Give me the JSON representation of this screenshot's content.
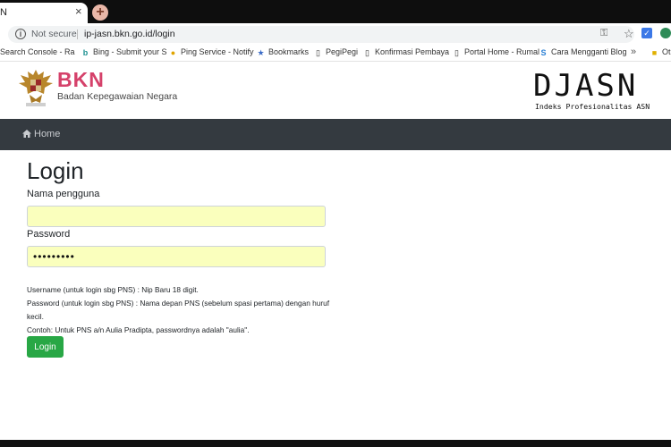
{
  "browser": {
    "tab_title": "N",
    "tab_close": "×",
    "new_tab": "+",
    "security_label": "Not secure",
    "url": "ip-jasn.bkn.go.id/login",
    "bookmarks": [
      {
        "label": "Search Console - Ra",
        "icon": "search-console-icon"
      },
      {
        "label": "Bing - Submit your S",
        "icon": "bing-icon"
      },
      {
        "label": "Ping Service - Notify",
        "icon": "ping-icon"
      },
      {
        "label": "Bookmarks",
        "icon": "star-icon"
      },
      {
        "label": "PegiPegi",
        "icon": "page-icon"
      },
      {
        "label": "Konfirmasi Pembaya",
        "icon": "page-icon"
      },
      {
        "label": "Portal Home - Rumal",
        "icon": "page-icon"
      },
      {
        "label": "Cara Mengganti Blog",
        "icon": "s-icon"
      }
    ],
    "bookmarks_more": "»",
    "other_folder": "Oth"
  },
  "header": {
    "logo_text": "BKN",
    "logo_subtitle": "Badan Kepegawaian Negara",
    "brand": "DJASN",
    "brand_subtitle": "Indeks Profesionalitas ASN"
  },
  "nav": {
    "home_label": "Home"
  },
  "form": {
    "title": "Login",
    "username_label": "Nama pengguna",
    "username_value": "",
    "password_label": "Password",
    "password_value": "•••••••••",
    "hint_1": "Username (untuk login sbg PNS) : Nip Baru 18 digit.",
    "hint_2": "Password (untuk login sbg PNS) : Nama depan PNS (sebelum spasi pertama) dengan huruf",
    "hint_2b": "kecil.",
    "hint_3": "Contoh: Untuk PNS a/n Aulia Pradipta, passwordnya adalah \"aulia\".",
    "submit_label": "Login"
  },
  "colors": {
    "accent_pink": "#d5416a",
    "navbar": "#343a40",
    "button_green": "#28a745",
    "autofill_yellow": "#faffbd"
  }
}
